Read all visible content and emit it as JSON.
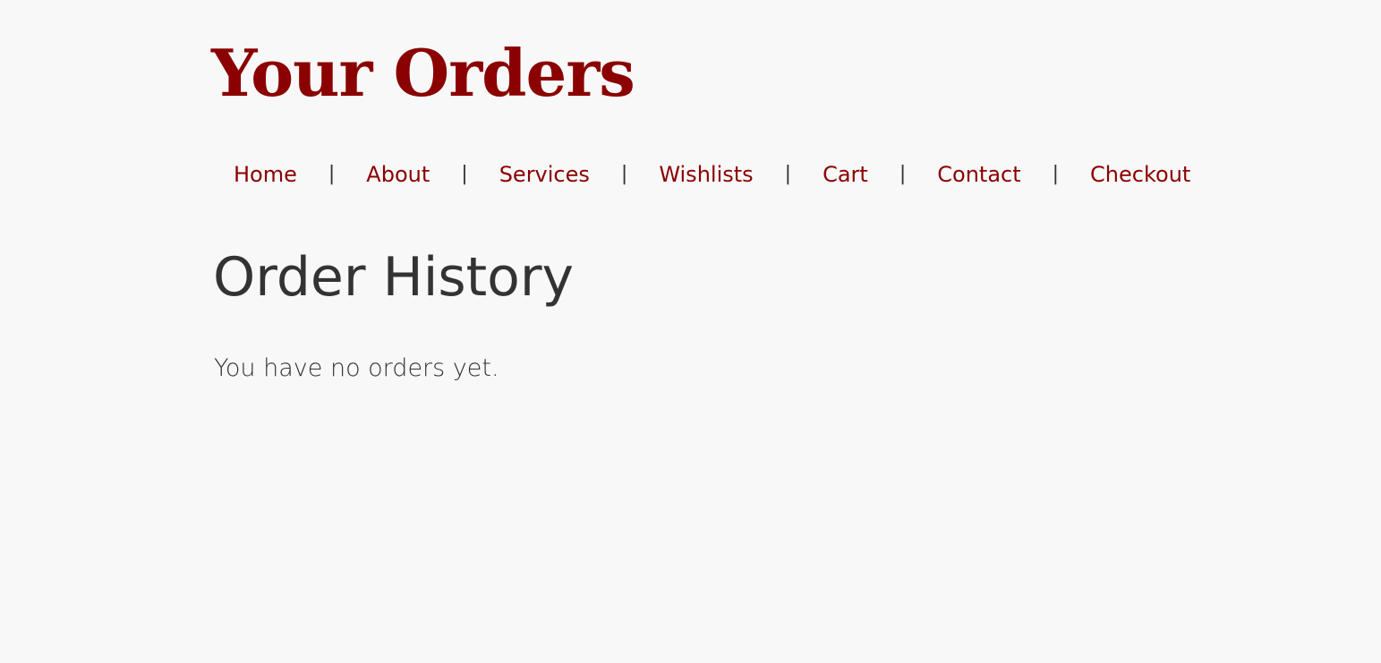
{
  "header": {
    "title": "Your Orders"
  },
  "nav": {
    "items": [
      {
        "label": "Home"
      },
      {
        "label": "About"
      },
      {
        "label": "Services"
      },
      {
        "label": "Wishlists"
      },
      {
        "label": "Cart"
      },
      {
        "label": "Contact"
      },
      {
        "label": "Checkout"
      }
    ],
    "separator": "|"
  },
  "main": {
    "section_title": "Order History",
    "empty_message": "You have no orders yet."
  },
  "colors": {
    "brand": "#8b0000",
    "text": "#333333",
    "background": "#f8f8f8"
  }
}
